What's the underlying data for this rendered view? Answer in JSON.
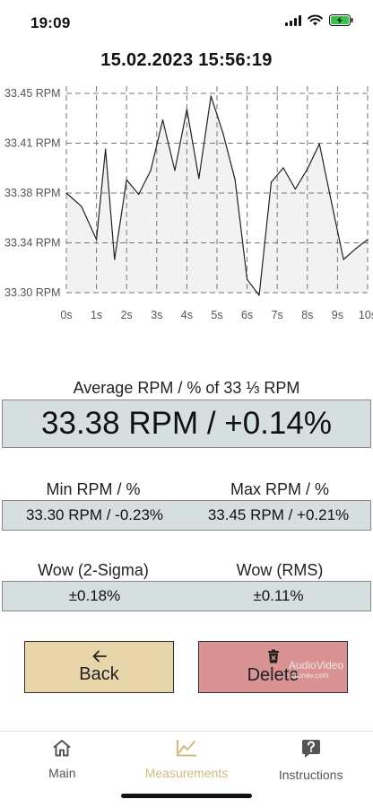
{
  "status_bar": {
    "time": "19:09"
  },
  "title": "15.02.2023 15:56:19",
  "chart_data": {
    "type": "area",
    "x": [
      0,
      0.5,
      1,
      1.3,
      1.6,
      2,
      2.4,
      2.8,
      3.2,
      3.6,
      4,
      4.4,
      4.8,
      5.2,
      5.6,
      6,
      6.4,
      6.8,
      7.2,
      7.6,
      8,
      8.4,
      8.8,
      9.2,
      9.6,
      10
    ],
    "y": [
      33.375,
      33.365,
      33.34,
      33.408,
      33.325,
      33.385,
      33.374,
      33.392,
      33.43,
      33.392,
      33.438,
      33.386,
      33.448,
      33.42,
      33.385,
      33.31,
      33.298,
      33.383,
      33.394,
      33.378,
      33.393,
      33.412,
      33.368,
      33.325,
      33.333,
      33.34
    ],
    "x_ticks": [
      "0s",
      "1s",
      "2s",
      "3s",
      "4s",
      "5s",
      "6s",
      "7s",
      "8s",
      "9s",
      "10s"
    ],
    "y_ticks": [
      "33.45 RPM",
      "33.41 RPM",
      "33.38 RPM",
      "33.34 RPM",
      "33.30 RPM"
    ],
    "xlim": [
      0,
      10
    ],
    "ylim": [
      33.3,
      33.45
    ],
    "grid": true,
    "line_color": "#222222",
    "fill_color": "#f2f2f2"
  },
  "average": {
    "label": "Average RPM / % of 33 ⅓ RPM",
    "value": "33.38 RPM / +0.14%"
  },
  "minmax": {
    "min_label": "Min RPM / %",
    "max_label": "Max RPM / %",
    "min_value": "33.30 RPM / -0.23%",
    "max_value": "33.45 RPM / +0.21%"
  },
  "wow": {
    "sigma_label": "Wow (2-Sigma)",
    "rms_label": "Wow (RMS)",
    "sigma_value": "±0.18%",
    "rms_value": "±0.11%"
  },
  "buttons": {
    "back": "Back",
    "delete": "Delete"
  },
  "watermark": {
    "line1": "AudioVideo",
    "line2": "salonav.com"
  },
  "tabs": [
    {
      "label": "Main",
      "icon": "home-icon"
    },
    {
      "label": "Measurements",
      "icon": "chart-line-icon",
      "active": true
    },
    {
      "label": "Instructions",
      "icon": "help-icon"
    }
  ],
  "colors": {
    "accent": "#d9b878",
    "back_button": "#e8d5aa",
    "delete_button": "#d99393",
    "value_box": "#d6dfe0"
  }
}
